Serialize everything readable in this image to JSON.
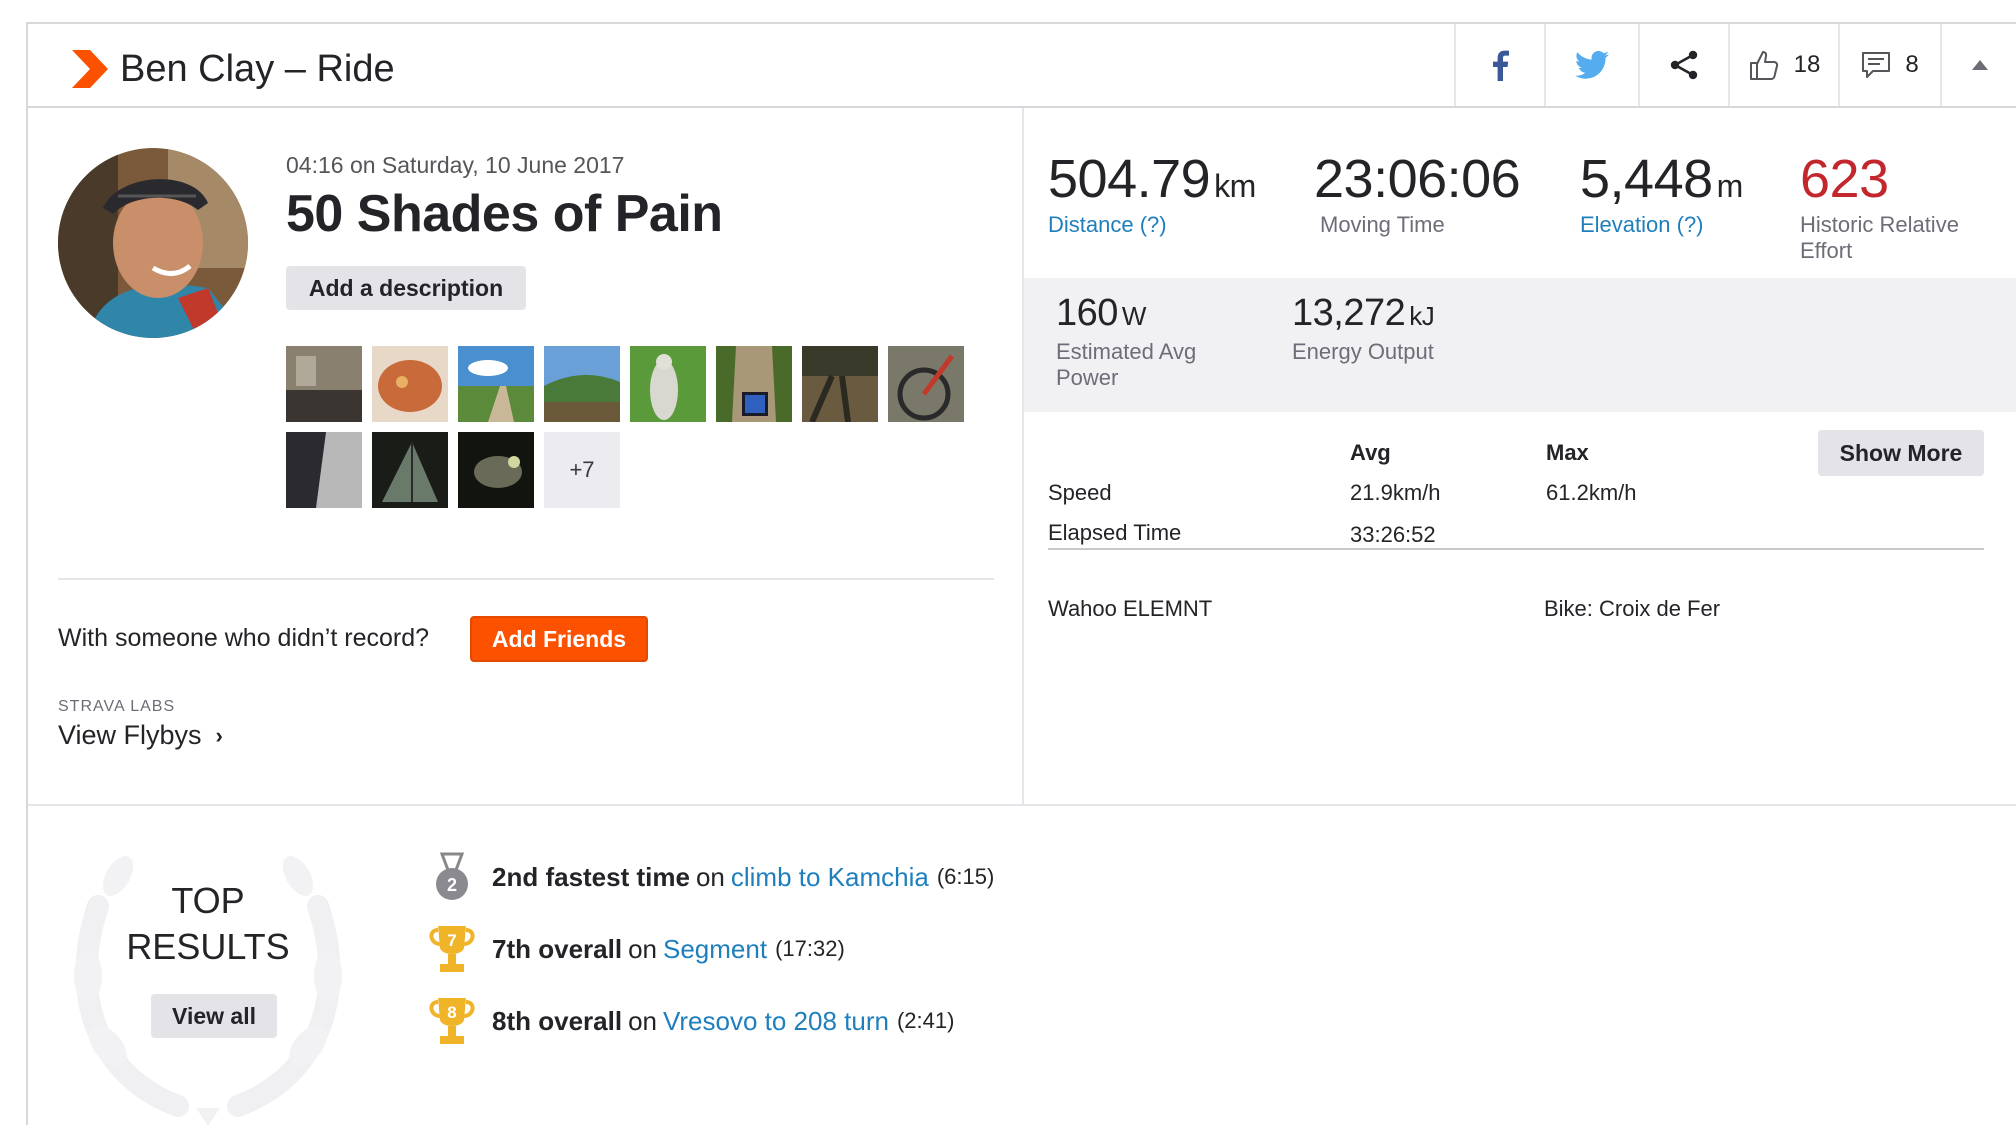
{
  "header": {
    "title": "Ben Clay – Ride",
    "kudos_count": "18",
    "comment_count": "8"
  },
  "activity": {
    "date": "04:16 on Saturday, 10 June 2017",
    "name": "50 Shades of Pain",
    "add_description_label": "Add a description",
    "more_photos_label": "+7",
    "friends_question": "With someone who didn’t record?",
    "add_friends_label": "Add Friends",
    "labs_label": "STRAVA LABS",
    "flybys_label": "View Flybys"
  },
  "stats": {
    "distance": {
      "value": "504.79",
      "unit": "km",
      "label": "Distance (?)"
    },
    "moving_time": {
      "value": "23:06:06",
      "label": "Moving Time"
    },
    "elevation": {
      "value": "5,448",
      "unit": "m",
      "label": "Elevation (?)"
    },
    "relative_effort": {
      "value": "623",
      "label_line1": "Historic Relative",
      "label_line2": "Effort"
    },
    "power": {
      "value": "160",
      "unit": "W",
      "label_line1": "Estimated Avg",
      "label_line2": "Power"
    },
    "energy": {
      "value": "13,272",
      "unit": "kJ",
      "label": "Energy Output"
    }
  },
  "table": {
    "col_avg": "Avg",
    "col_max": "Max",
    "show_more_label": "Show More",
    "rows": [
      {
        "label": "Speed",
        "avg": "21.9km/h",
        "max": "61.2km/h"
      },
      {
        "label": "Elapsed Time",
        "avg": "33:26:52",
        "max": ""
      }
    ],
    "device": "Wahoo ELEMNT",
    "bike": "Bike: Croix de Fer"
  },
  "top_results": {
    "line1": "TOP",
    "line2": "RESULTS",
    "view_all_label": "View all",
    "items": [
      {
        "rank": "2",
        "achievement": "2nd fastest time",
        "on": "on",
        "segment": "climb to Kamchia",
        "time": "(6:15)",
        "medal": "silver-medal"
      },
      {
        "rank": "7",
        "achievement": "7th overall",
        "on": "on",
        "segment": "Segment",
        "time": "(17:32)",
        "medal": "gold-trophy"
      },
      {
        "rank": "8",
        "achievement": "8th overall",
        "on": "on",
        "segment": "Vresovo to 208 turn",
        "time": "(2:41)",
        "medal": "gold-trophy"
      }
    ]
  },
  "colors": {
    "brand_orange": "#fc5200",
    "link_blue": "#1f7fbd",
    "effort_red": "#c1272d",
    "facebook_blue": "#3b5998",
    "twitter_blue": "#55acee",
    "trophy_gold": "#f0b429"
  }
}
